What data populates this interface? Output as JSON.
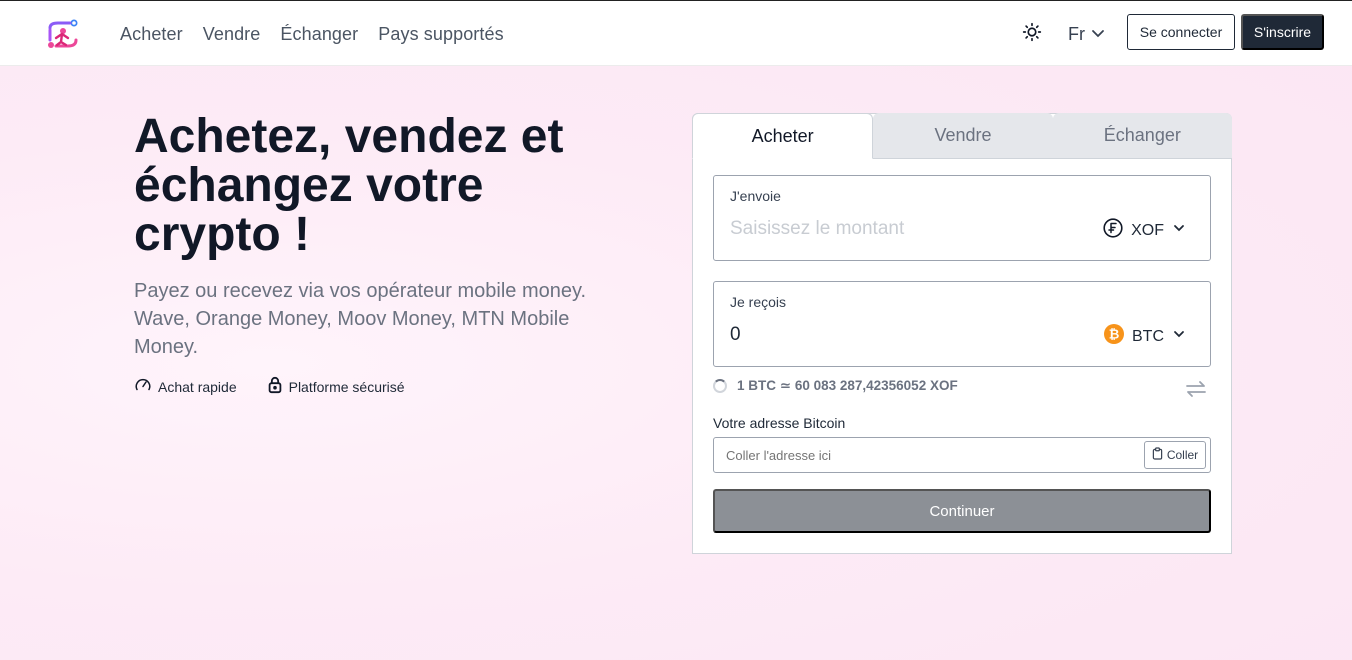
{
  "header": {
    "nav": [
      "Acheter",
      "Vendre",
      "Échanger",
      "Pays supportés"
    ],
    "language": "Fr",
    "login_label": "Se connecter",
    "signup_label": "S'inscrire"
  },
  "hero": {
    "title": "Achetez, vendez et échangez votre crypto !",
    "subtitle": "Payez ou recevez via vos opérateur mobile money. Wave, Orange Money, Moov Money, MTN Mobile Money.",
    "features": [
      "Achat rapide",
      "Platforme sécurisé"
    ]
  },
  "widget": {
    "tabs": [
      "Acheter",
      "Vendre",
      "Échanger"
    ],
    "active_tab": "Acheter",
    "send": {
      "label": "J'envoie",
      "placeholder": "Saisissez le montant",
      "currency": "XOF"
    },
    "receive": {
      "label": "Je reçois",
      "value": "0",
      "currency": "BTC"
    },
    "rate": "1 BTC ≃ 60 083 287,42356052 XOF",
    "address": {
      "label": "Votre adresse Bitcoin",
      "placeholder": "Coller l'adresse ici",
      "paste_label": "Coller"
    },
    "continue_label": "Continuer"
  },
  "icons": {
    "theme": "sun-icon",
    "language_chevron": "chevron-down-icon",
    "xof": "franc-icon",
    "btc": "bitcoin-icon",
    "swap": "swap-arrows-icon",
    "paste": "clipboard-icon",
    "feature_speed": "speedometer-icon",
    "feature_secure": "lock-icon"
  },
  "colors": {
    "primary_dark": "#1f2937",
    "bitcoin_orange": "#f7931a",
    "continue_disabled": "#8c9096",
    "background_pink": "#fdebf6"
  }
}
